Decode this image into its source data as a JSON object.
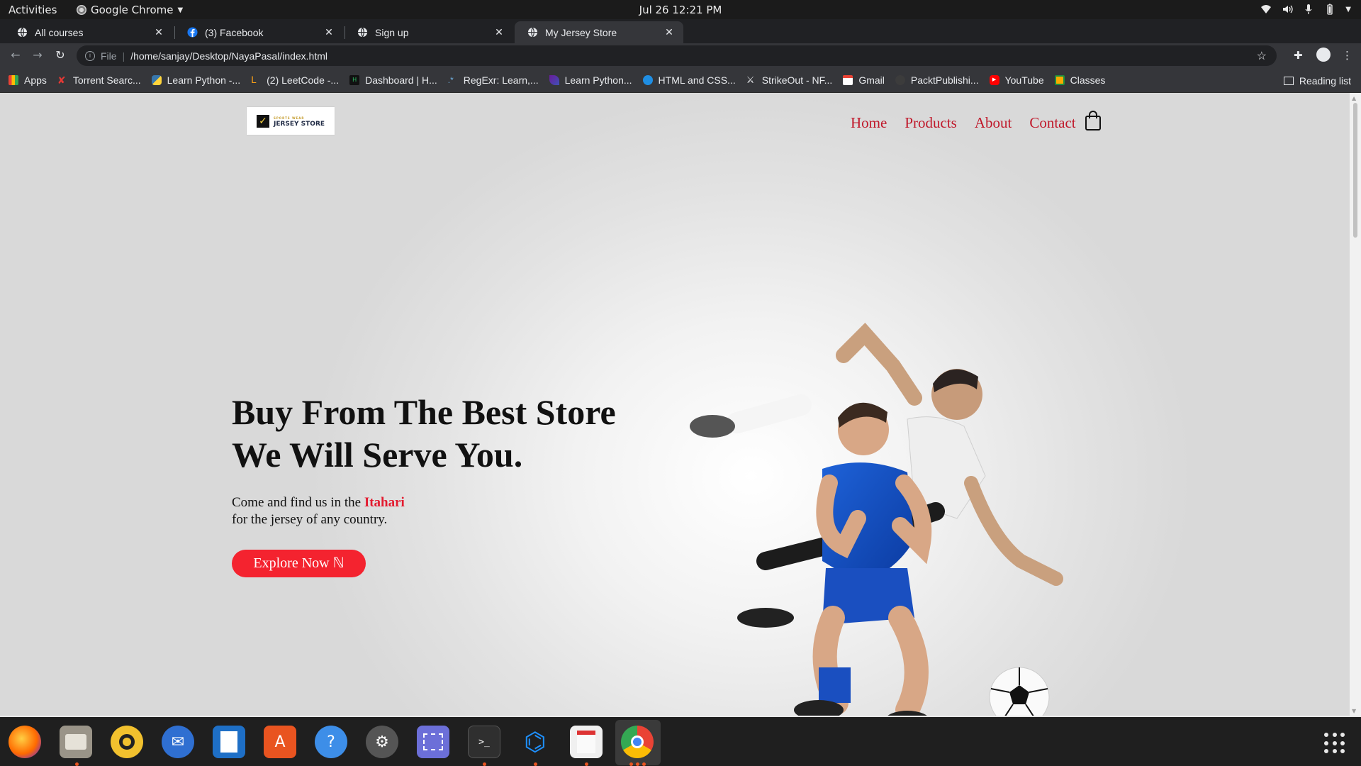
{
  "system_bar": {
    "activities": "Activities",
    "app_name": "Google Chrome",
    "clock": "Jul 26  12:21 PM"
  },
  "browser": {
    "tabs": [
      {
        "title": "All courses",
        "icon": "globe-icon"
      },
      {
        "title": "(3) Facebook",
        "icon": "facebook-icon"
      },
      {
        "title": "Sign up",
        "icon": "globe-icon"
      },
      {
        "title": "My Jersey Store",
        "icon": "globe-icon",
        "active": true
      }
    ],
    "address": {
      "scheme": "File",
      "url": "/home/sanjay/Desktop/NayaPasal/index.html"
    },
    "bookmarks": [
      {
        "label": "Apps",
        "icon": "apps-grid-icon"
      },
      {
        "label": "Torrent Searc...",
        "icon": "torrent-icon"
      },
      {
        "label": "Learn Python -...",
        "icon": "python-icon"
      },
      {
        "label": "(2) LeetCode -...",
        "icon": "leetcode-icon"
      },
      {
        "label": "Dashboard | H...",
        "icon": "hackerrank-icon"
      },
      {
        "label": "RegExr: Learn,...",
        "icon": "regexr-icon"
      },
      {
        "label": "Learn Python...",
        "icon": "python-feather-icon"
      },
      {
        "label": "HTML and CSS...",
        "icon": "codecademy-icon"
      },
      {
        "label": "StrikeOut - NF...",
        "icon": "strikeout-icon"
      },
      {
        "label": "Gmail",
        "icon": "gmail-icon"
      },
      {
        "label": "PacktPublishi...",
        "icon": "github-icon"
      },
      {
        "label": "YouTube",
        "icon": "youtube-icon"
      },
      {
        "label": "Classes",
        "icon": "classroom-icon"
      }
    ],
    "reading_list": "Reading list"
  },
  "site": {
    "logo": {
      "text": "JERSEY STORE",
      "sub": "SPORTS WEAR"
    },
    "nav": [
      "Home",
      "Products",
      "About",
      "Contact"
    ],
    "hero": {
      "title_line1": "Buy From The Best Store",
      "title_line2": "We Will Serve You.",
      "text_before": "Come and find us in the ",
      "text_highlight": "Itahari",
      "text_line2": "for the jersey of any country.",
      "button": "Explore Now ℕ"
    }
  },
  "dock": {
    "apps": [
      "firefox-icon",
      "files-icon",
      "rhythmbox-icon",
      "thunderbird-icon",
      "writer-icon",
      "software-icon",
      "help-icon",
      "settings-icon",
      "screenshot-icon",
      "terminal-icon",
      "vscode-icon",
      "document-viewer-icon",
      "chrome-icon"
    ]
  },
  "colors": {
    "accent_red": "#f4232f",
    "nav_red": "#c0182a",
    "chrome_dark": "#202124",
    "chrome_toolbar": "#35363a"
  }
}
